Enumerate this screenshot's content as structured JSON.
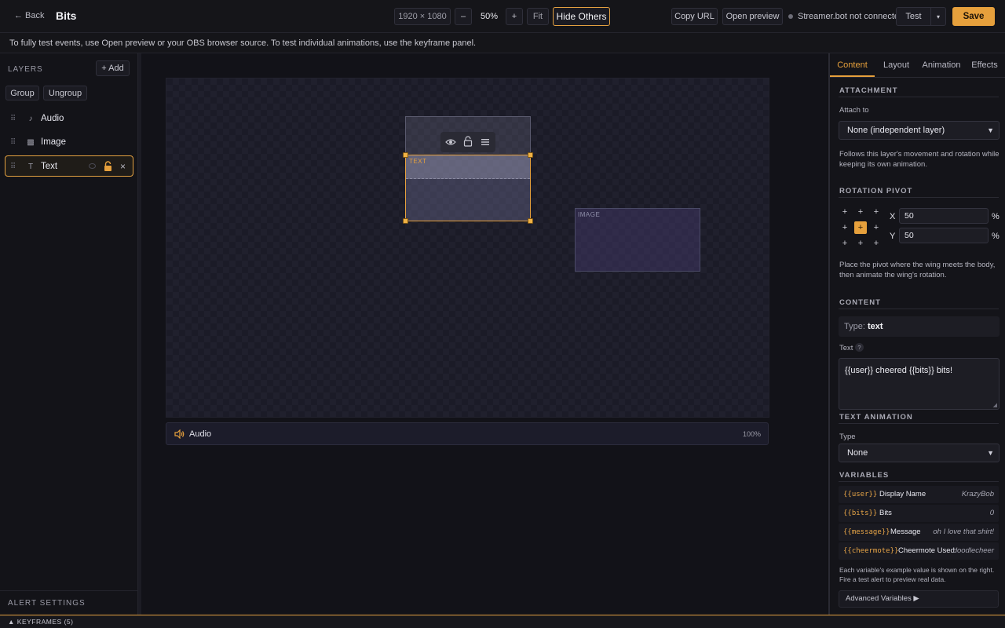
{
  "header": {
    "back_label": "← Back",
    "title": "Bits",
    "resolution": "1920 × 1080",
    "zoom_out": "–",
    "zoom_value": "50%",
    "zoom_in": "+",
    "fit": "Fit",
    "hide_others": "Hide Others",
    "copy_url": "Copy URL",
    "open_preview": "Open preview",
    "connection_status": "Streamer.bot not connected",
    "test": "Test",
    "test_menu": "▾",
    "save": "Save"
  },
  "info_text": "To fully test events, use Open preview or your OBS browser source. To test individual animations, use the keyframe panel.",
  "layers": {
    "title": "LAYERS",
    "add": "+ Add",
    "group": "Group",
    "ungroup": "Ungroup",
    "items": [
      {
        "name": "Audio",
        "icon": "♪"
      },
      {
        "name": "Image",
        "icon": "▩"
      },
      {
        "name": "Text",
        "icon": "T"
      }
    ],
    "alert_settings": "ALERT SETTINGS"
  },
  "canvas": {
    "text_layer_label": "TEXT",
    "image_layer_label": "IMAGE",
    "audio_label": "Audio",
    "audio_volume": "100%"
  },
  "panel": {
    "tabs": [
      "Content",
      "Layout",
      "Animation",
      "Effects"
    ],
    "active_tab": "Content",
    "attachment_title": "ATTACHMENT",
    "attach_to_label": "Attach to",
    "attach_to_value": "None (independent layer)",
    "attach_help": "Follows this layer's movement and rotation while keeping its own animation.",
    "pivot_title": "ROTATION PIVOT",
    "pivot_x_label": "X",
    "pivot_x": "50",
    "pivot_y_label": "Y",
    "pivot_y": "50",
    "pct": "%",
    "pivot_help": "Place the pivot where the wing meets the body, then animate the wing's rotation.",
    "content_title": "CONTENT",
    "type_prefix": "Type:",
    "type_value": "text",
    "text_label": "Text",
    "text_value": "{{user}} cheered {{bits}} bits!",
    "text_anim_title": "TEXT ANIMATION",
    "anim_type_label": "Type",
    "anim_type_value": "None",
    "variables_title": "VARIABLES",
    "variables": [
      {
        "token": "{{user}}",
        "name": "Display Name",
        "example": "KrazyBob"
      },
      {
        "token": "{{bits}}",
        "name": "Bits",
        "example": "0"
      },
      {
        "token": "{{message}}",
        "name": "Message",
        "example": "oh I love that shirt!"
      },
      {
        "token": "{{cheermote}}",
        "name": "Cheermote Used",
        "example": "doodlecheer"
      }
    ],
    "variables_help": "Each variable's example value is shown on the right. Fire a test alert to preview real data.",
    "advanced_variables": "Advanced Variables ▶"
  },
  "keyframes_label": "▲ KEYFRAMES (5)",
  "colors": {
    "accent": "#e6a03c",
    "background": "#111116"
  }
}
